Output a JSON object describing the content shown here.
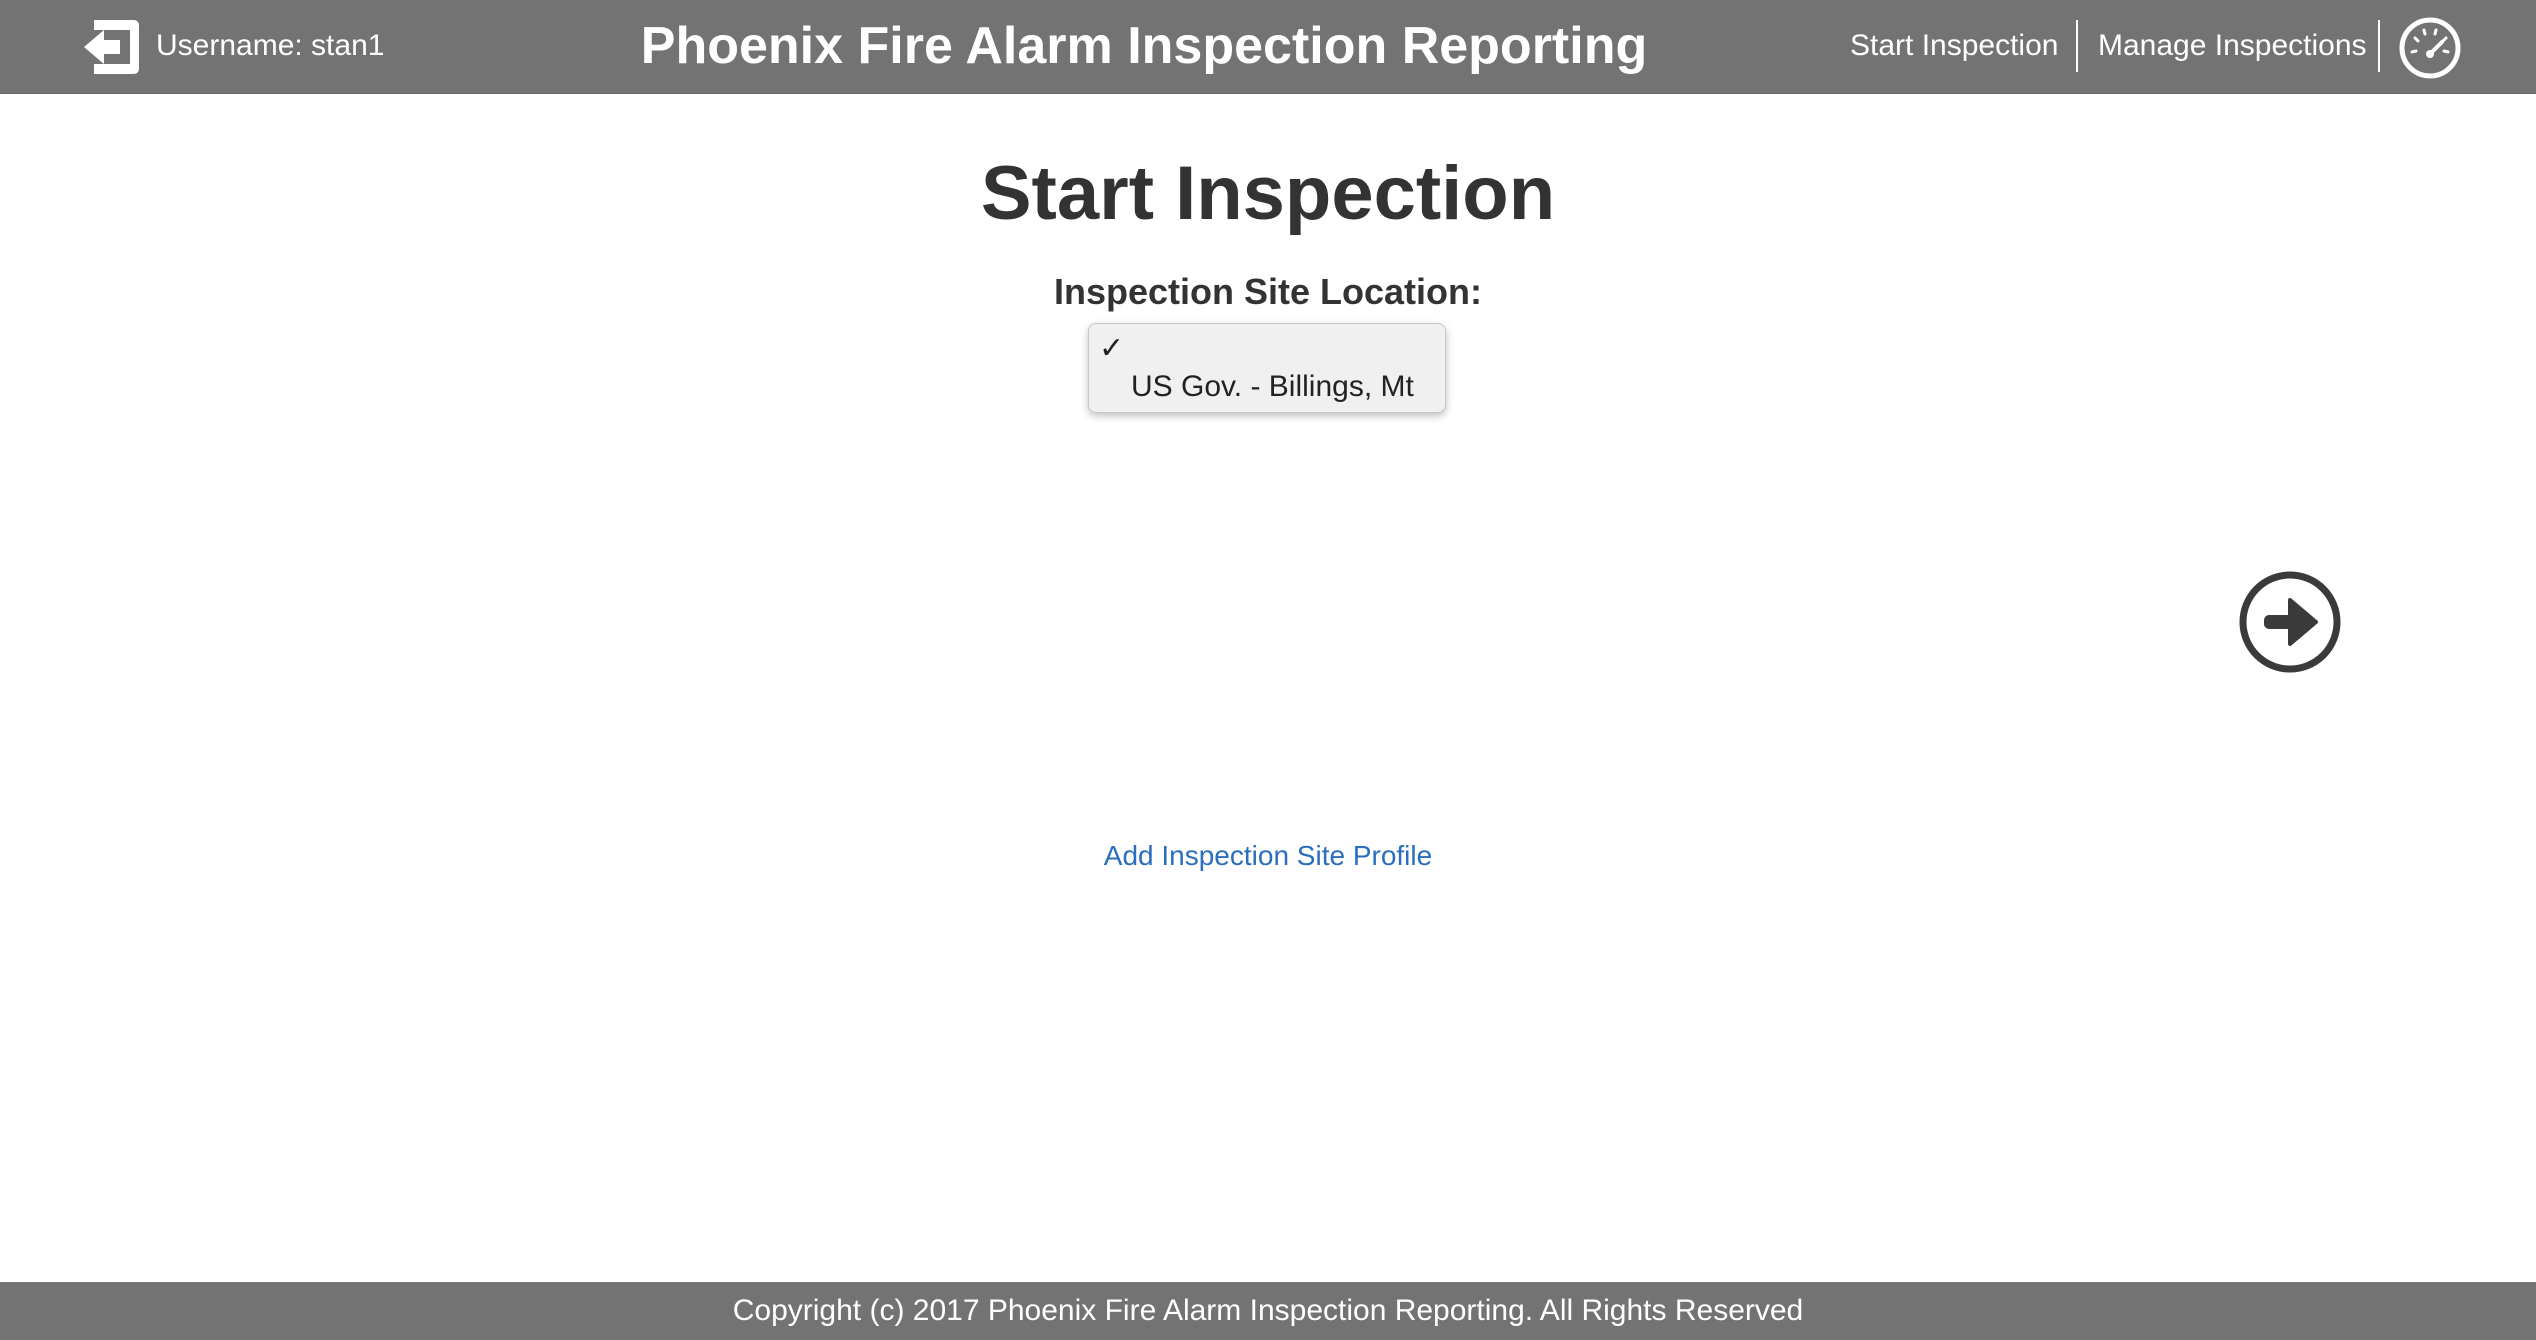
{
  "header": {
    "username_label": "Username: stan1",
    "app_title": "Phoenix Fire Alarm Inspection Reporting",
    "nav": {
      "start_inspection": "Start Inspection",
      "manage_inspections": "Manage Inspections"
    },
    "logout_icon": "logout-arrow-icon",
    "dashboard_icon": "speedometer-icon",
    "background_color": "#737373"
  },
  "main": {
    "heading": "Start Inspection",
    "site_location_label": "Inspection Site Location:",
    "site_dropdown": {
      "check_mark": "✓",
      "options": [
        {
          "label": "",
          "selected": true
        },
        {
          "label": "US Gov. - Billings, Mt",
          "selected": false
        }
      ]
    },
    "next_icon": "circle-arrow-right-icon",
    "add_site_link": "Add Inspection Site Profile",
    "link_color": "#2a6ebd"
  },
  "footer": {
    "text": "Copyright (c) 2017 Phoenix Fire Alarm Inspection Reporting. All Rights Reserved"
  }
}
